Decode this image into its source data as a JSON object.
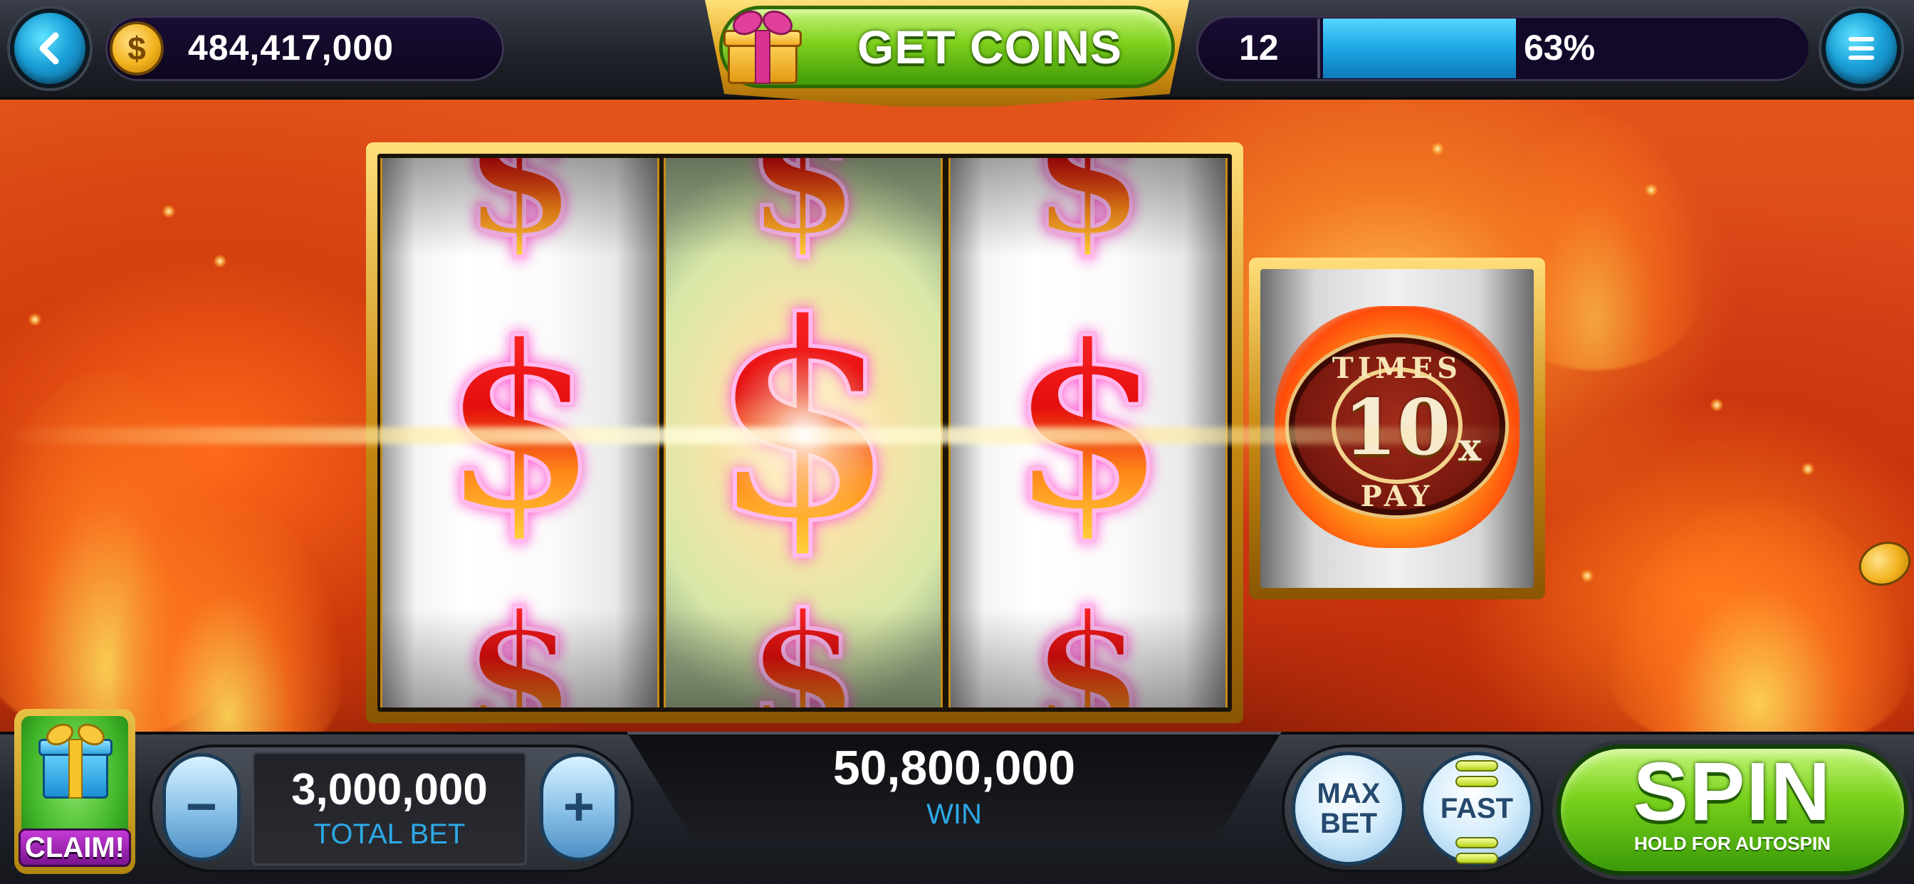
{
  "header": {
    "coin_balance": "484,417,000",
    "coin_symbol": "$",
    "get_coins_label": "GET COINS",
    "level": "12",
    "xp_percent_label": "63%",
    "xp_fraction": 0.63
  },
  "reels": [
    {
      "top": "$",
      "middle": "$",
      "bottom": "$"
    },
    {
      "top": "$",
      "middle": "$",
      "bottom": "$"
    },
    {
      "top": "$",
      "middle": "$",
      "bottom": "$"
    }
  ],
  "multiplier": {
    "times": "TIMES",
    "value": "10",
    "suffix": "x",
    "pay": "PAY"
  },
  "footer": {
    "claim_label": "CLAIM!",
    "bet_minus": "−",
    "bet_plus": "+",
    "total_bet_value": "3,000,000",
    "total_bet_label": "TOTAL BET",
    "win_value": "50,800,000",
    "win_label": "WIN",
    "max_bet_line1": "MAX",
    "max_bet_line2": "BET",
    "fast_label": "FAST",
    "spin_label": "SPIN",
    "spin_sub": "HOLD FOR AUTOSPIN"
  },
  "icons": {
    "back": "back-chevron-icon",
    "menu": "menu-icon",
    "coin": "coin-icon",
    "gift": "gift-icon"
  },
  "colors": {
    "accent_green": "#7fd01c",
    "accent_blue": "#1ea7e6",
    "label_blue": "#2ea9e6",
    "gold": "#e1a11a"
  }
}
